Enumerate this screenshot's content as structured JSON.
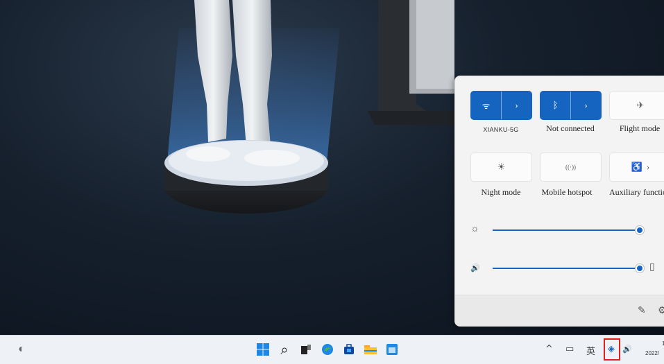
{
  "quick_settings": {
    "tiles": [
      {
        "id": "wifi",
        "label": "XIANKU-5G",
        "state": "on",
        "icon": "wifi-icon",
        "glyph_main": "ᯤ",
        "glyph_expand": "›"
      },
      {
        "id": "bluetooth",
        "label": "Not connected",
        "state": "on",
        "icon": "bluetooth-icon",
        "glyph_main": "ᛒ",
        "glyph_expand": "›"
      },
      {
        "id": "flight",
        "label": "Flight mode",
        "state": "off",
        "icon": "airplane-icon",
        "glyph_main": "✈"
      },
      {
        "id": "night",
        "label": "Night mode",
        "state": "off",
        "icon": "night-light-icon",
        "glyph_main": "☀"
      },
      {
        "id": "hotspot",
        "label": "Mobile hotspot",
        "state": "off",
        "icon": "hotspot-icon",
        "glyph_main": "((·))"
      },
      {
        "id": "accessibility",
        "label": "Auxiliary function",
        "state": "off",
        "icon": "accessibility-icon",
        "glyph_main": "♿",
        "glyph_expand": "›"
      }
    ],
    "brightness": {
      "level": 1.0,
      "icon": "sun-icon",
      "glyph": "☼"
    },
    "volume": {
      "level": 1.0,
      "icon": "speaker-icon",
      "glyph": "🔊",
      "extra_icon": "audio-device-icon",
      "extra_glyph": "▯"
    },
    "footer": {
      "edit_glyph": "✎",
      "settings_glyph": "⚙"
    },
    "accent_color": "#1565c0"
  },
  "taskbar": {
    "widgets_glyph": "◐",
    "search_glyph": "⌕",
    "tray": {
      "chevron": "^",
      "keyboard_glyph": "▭",
      "ime_label": "英",
      "network_glyph": "◈",
      "volume_glyph": "🔊"
    },
    "clock": {
      "time": "1",
      "date": "2022/"
    },
    "highlighted_item": "network-tray-icon",
    "highlight_color": "#e02020"
  }
}
